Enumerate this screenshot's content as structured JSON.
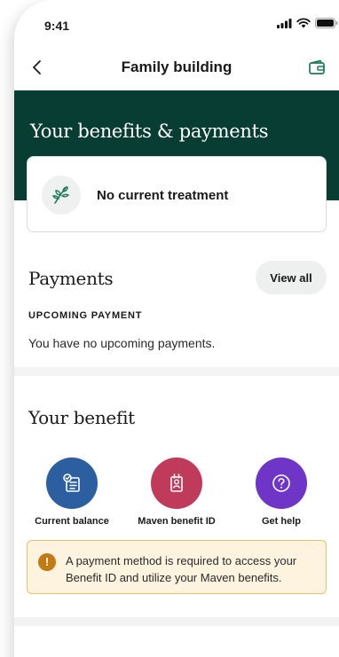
{
  "status_bar": {
    "time": "9:41"
  },
  "nav": {
    "title": "Family building"
  },
  "hero": {
    "title": "Your benefits & payments"
  },
  "treatment": {
    "label": "No current treatment"
  },
  "payments": {
    "title": "Payments",
    "view_all": "View all",
    "upcoming_label": "UPCOMING PAYMENT",
    "upcoming_text": "You have no upcoming payments."
  },
  "benefit": {
    "title": "Your benefit",
    "tiles": [
      {
        "label": "Current balance",
        "icon": "balance-icon",
        "color": "#2c5f9f"
      },
      {
        "label": "Maven benefit ID",
        "icon": "id-badge-icon",
        "color": "#c03a5c"
      },
      {
        "label": "Get help",
        "icon": "help-icon",
        "color": "#6f35c6"
      }
    ]
  },
  "alert": {
    "text": "A payment method is required to access your Benefit ID and utilize your Maven benefits."
  },
  "colors": {
    "hero_bg": "#073d33",
    "accent_green": "#1f7a5c",
    "alert_bg": "#fdf3df",
    "alert_border": "#e9c16d",
    "alert_icon": "#c27b13"
  }
}
